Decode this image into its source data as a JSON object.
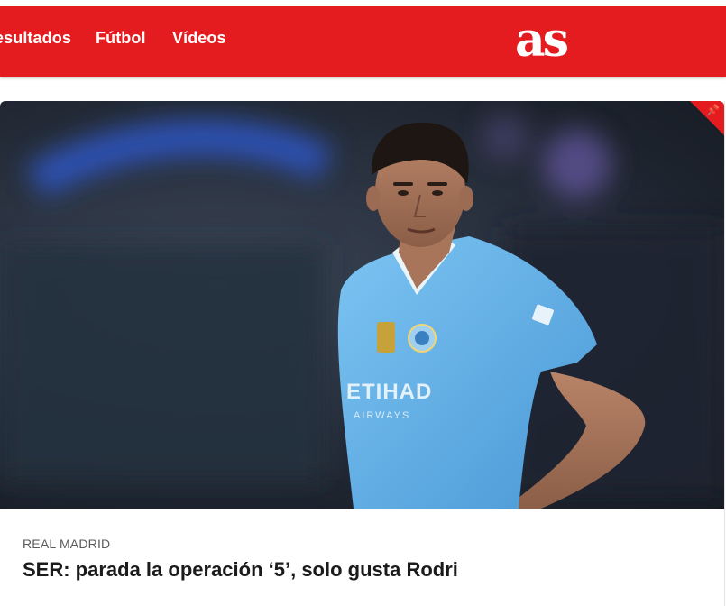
{
  "nav": {
    "items": [
      {
        "label": "esultados"
      },
      {
        "label": "Fútbol"
      },
      {
        "label": "Vídeos"
      }
    ]
  },
  "logo": {
    "text": "as"
  },
  "article": {
    "section": "REAL MADRID",
    "headline": "SER: parada la operación ‘5’, solo gusta Rodri",
    "pinned": true,
    "photo_shirt_sponsor": "ETIHAD"
  },
  "colors": {
    "brand_red": "#e41c1f",
    "shirt_blue": "#6cb5ea",
    "text_dark": "#1b1b1b",
    "text_muted": "#5b5b5b"
  }
}
